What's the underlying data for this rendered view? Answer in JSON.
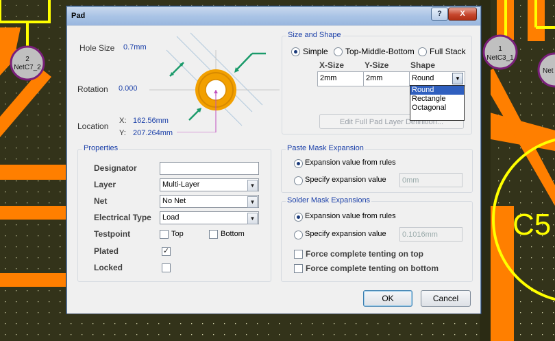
{
  "window": {
    "title": "Pad",
    "help_label": "?",
    "close_label": "X"
  },
  "preview": {
    "hole_size_label": "Hole Size",
    "hole_size_value": "0.7mm",
    "rotation_label": "Rotation",
    "rotation_value": "0.000",
    "location_label": "Location",
    "x_label": "X:",
    "x_value": "162.56mm",
    "y_label": "Y:",
    "y_value": "207.264mm"
  },
  "size_shape": {
    "title": "Size and Shape",
    "modes": [
      "Simple",
      "Top-Middle-Bottom",
      "Full Stack"
    ],
    "selected_mode": "Simple",
    "headers": [
      "X-Size",
      "Y-Size",
      "Shape"
    ],
    "row": {
      "x_size": "2mm",
      "y_size": "2mm",
      "shape": "Round"
    },
    "shape_options": [
      "Round",
      "Rectangle",
      "Octagonal"
    ],
    "highlighted_option": "Round",
    "edit_button": "Edit Full Pad Layer Definition..."
  },
  "properties": {
    "title": "Properties",
    "designator_label": "Designator",
    "designator_value": "",
    "layer_label": "Layer",
    "layer_value": "Multi-Layer",
    "net_label": "Net",
    "net_value": "No Net",
    "electrical_type_label": "Electrical Type",
    "electrical_type_value": "Load",
    "testpoint_label": "Testpoint",
    "testpoint_top_label": "Top",
    "testpoint_bottom_label": "Bottom",
    "testpoint_top_checked": false,
    "testpoint_bottom_checked": false,
    "plated_label": "Plated",
    "plated_checked": true,
    "locked_label": "Locked",
    "locked_checked": false
  },
  "paste_mask": {
    "title": "Paste Mask Expansion",
    "from_rules_label": "Expansion value from rules",
    "specify_label": "Specify expansion value",
    "selected": "from_rules",
    "value": "0mm"
  },
  "solder_mask": {
    "title": "Solder Mask Expansions",
    "from_rules_label": "Expansion value from rules",
    "specify_label": "Specify expansion value",
    "selected": "from_rules",
    "value": "0.1016mm",
    "tent_top_label": "Force complete tenting on top",
    "tent_bottom_label": "Force complete tenting on bottom",
    "tent_top_checked": false,
    "tent_bottom_checked": false
  },
  "buttons": {
    "ok": "OK",
    "cancel": "Cancel"
  },
  "pcb": {
    "left_pad_number": "2",
    "left_pad_net": "NetC7_2",
    "right_pad_number": "1",
    "right_pad_net": "NetC3_1",
    "edge_pad_net": "Net",
    "component_label": "C5"
  },
  "colors": {
    "board": "#33331a",
    "track": "#ff7f00",
    "silkscreen": "#ffff00",
    "pad": "#c0c0c0",
    "accent": "#1a3fa8"
  }
}
